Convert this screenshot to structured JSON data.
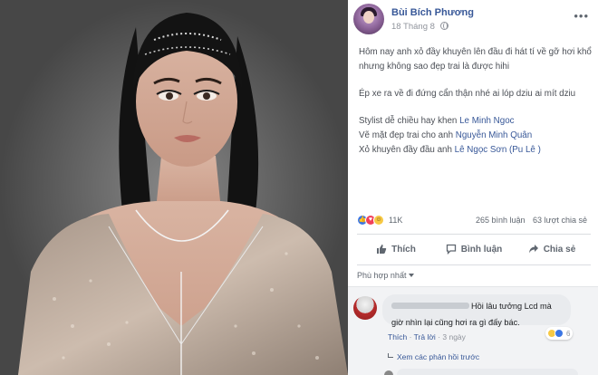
{
  "post": {
    "author": "Bùi Bích Phương",
    "timestamp": "18 Tháng 8",
    "paragraphs": [
      "Hôm nay anh xỏ đầy khuyên lên đầu đi hát tí về gỡ hơi khổ nhưng không sao đẹp trai là được hihi",
      "Ép xe ra về đi đứng cẩn thận nhé ai lóp dziu ai mít dziu"
    ],
    "credits": [
      {
        "text": "Stylist dễ chiều hay khen ",
        "link": "Le Minh Ngoc",
        "suffix": ""
      },
      {
        "text": "Vẽ mặt đẹp trai cho anh ",
        "link": "Nguyễn Minh Quân",
        "suffix": ""
      },
      {
        "text": "Xỏ khuyên đầy đầu anh ",
        "link": "Lê Ngọc Sơn (Pu Lê",
        "suffix": " )"
      }
    ]
  },
  "stats": {
    "reactions_count": "11K",
    "comments": "265 bình luận",
    "shares": "63 lượt chia sẻ"
  },
  "actions": {
    "like": "Thích",
    "comment": "Bình luận",
    "share": "Chia sẻ"
  },
  "sort": {
    "label": "Phù hợp nhất"
  },
  "comment": {
    "text": "Hồi lâu tưởng Lcd mà giờ nhìn lại cũng hơi ra gì đấy bác.",
    "like_label": "Thích",
    "reply_label": "Trả lời",
    "time": "3 ngày",
    "reaction_count": "6",
    "view_replies": "Xem các phản hồi trước"
  },
  "colors": {
    "link": "#385898",
    "text": "#4b4f56",
    "muted": "#90949c"
  }
}
